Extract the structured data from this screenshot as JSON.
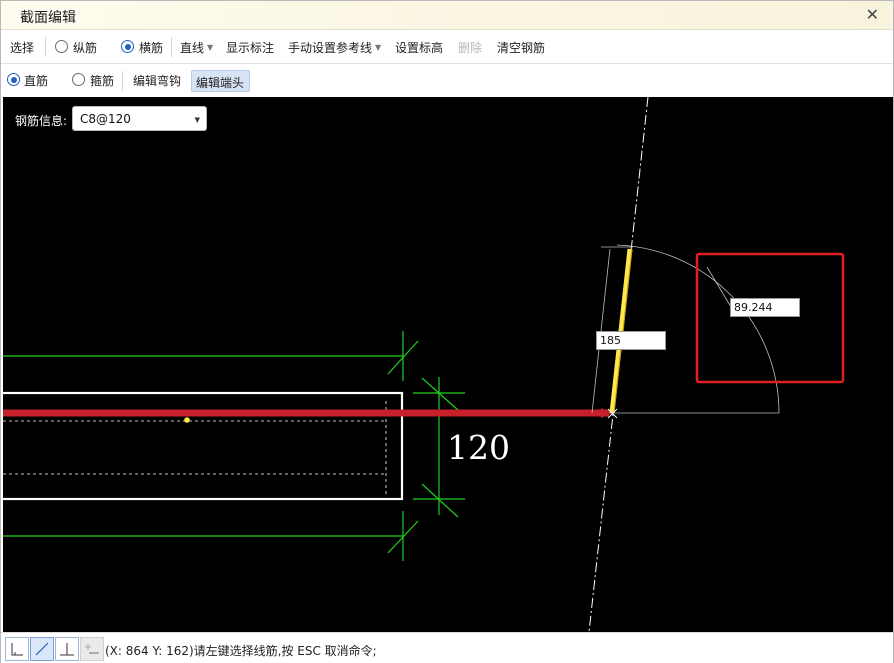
{
  "window": {
    "title": "截面编辑",
    "close_glyph": "✕"
  },
  "toolbar1": {
    "select": "选择",
    "longitudinal": "纵筋",
    "transverse": "横筋",
    "line": "直线",
    "show_dimension": "显示标注",
    "manual_ref_line": "手动设置参考线",
    "set_elevation": "设置标高",
    "delete": "删除",
    "clear_rebar": "清空钢筋",
    "selected_radio": "transverse"
  },
  "toolbar2": {
    "straight_bar": "直筋",
    "stirrup": "箍筋",
    "edit_hook": "编辑弯钩",
    "edit_end": "编辑端头",
    "selected_radio": "straight_bar",
    "active_button": "edit_end"
  },
  "canvas": {
    "rebar_info_label": "钢筋信息:",
    "rebar_info_value": "C8@120",
    "dimension_thickness": "120",
    "input_length": "185",
    "input_angle": "89.244"
  },
  "status": {
    "message": "(X: 864 Y: 162)请左键选择线筋,按 ESC 取消命令;"
  },
  "colors": {
    "canvas_bg": "#000000",
    "rebar_red": "#c8202a",
    "dimension_green": "#1fd21f",
    "highlight_yellow": "#ffe84a",
    "selection_box": "#e0201e"
  }
}
